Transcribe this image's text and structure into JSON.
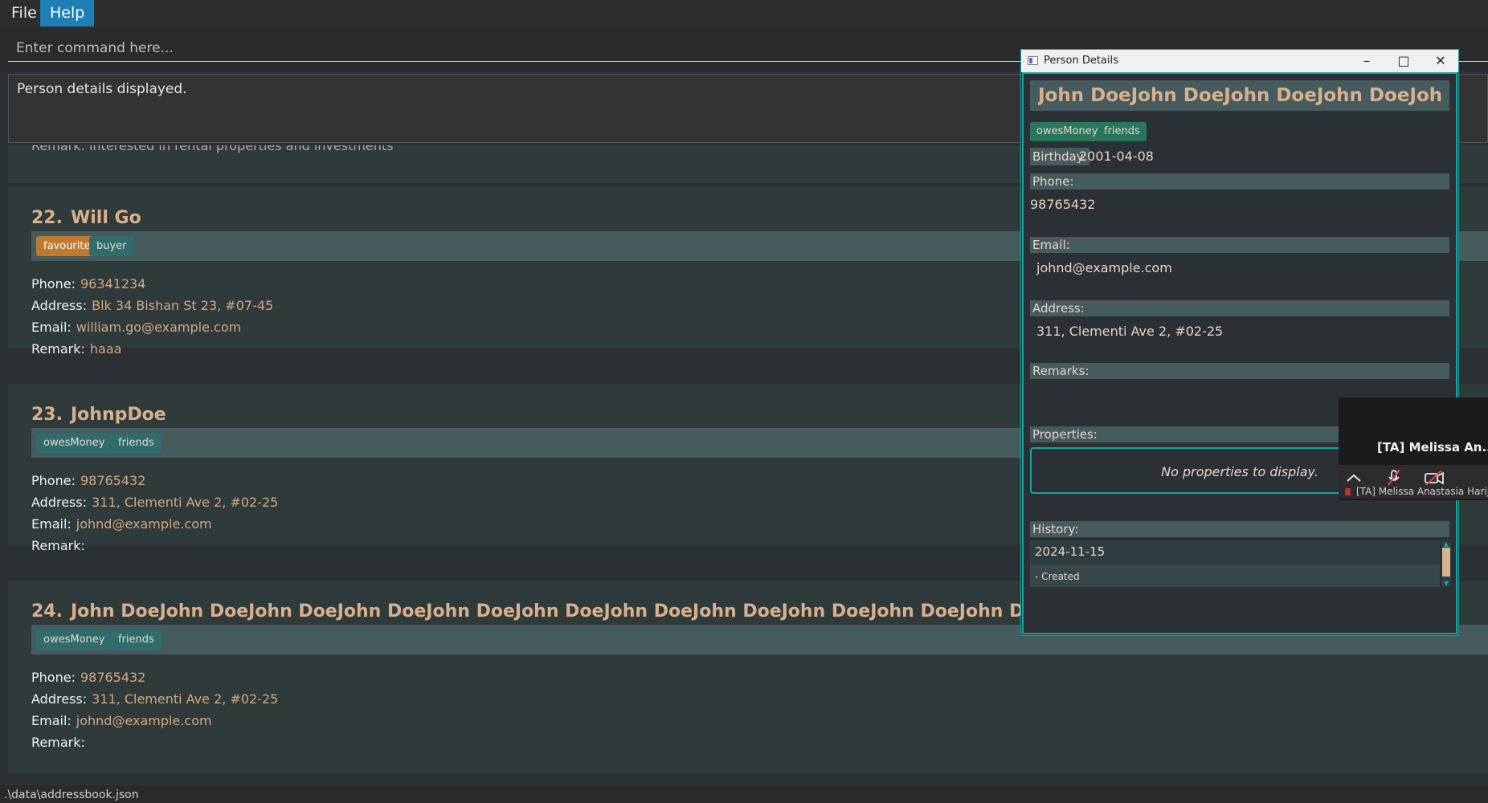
{
  "menu": {
    "file": "File",
    "help": "Help"
  },
  "command": {
    "placeholder": "Enter command here..."
  },
  "result": {
    "text": "Person details displayed."
  },
  "list": {
    "partial_text": "Remark: interested in rental properties and investments",
    "cards": [
      {
        "index": "22.",
        "name": "Will Go",
        "tags": [
          "favourite",
          "buyer"
        ],
        "phone_label": "Phone:",
        "phone": "96341234",
        "address_label": "Address:",
        "address": "Blk 34 Bishan St 23, #07-45",
        "email_label": "Email:",
        "email": "william.go@example.com",
        "remark_label": "Remark:",
        "remark": "haaa"
      },
      {
        "index": "23.",
        "name": "JohnpDoe",
        "tags": [
          "owesMoney",
          "friends"
        ],
        "phone_label": "Phone:",
        "phone": "98765432",
        "address_label": "Address:",
        "address": "311, Clementi Ave 2, #02-25",
        "email_label": "Email:",
        "email": "johnd@example.com",
        "remark_label": "Remark:",
        "remark": ""
      },
      {
        "index": "24.",
        "name": "John DoeJohn DoeJohn DoeJohn DoeJohn DoeJohn DoeJohn DoeJohn DoeJohn DoeJohn DoeJohn D...",
        "tags": [
          "owesMoney",
          "friends"
        ],
        "phone_label": "Phone:",
        "phone": "98765432",
        "address_label": "Address:",
        "address": "311, Clementi Ave 2, #02-25",
        "email_label": "Email:",
        "email": "johnd@example.com",
        "remark_label": "Remark:",
        "remark": ""
      }
    ]
  },
  "status": {
    "path": ".\\data\\addressbook.json"
  },
  "details_window": {
    "title": "Person Details",
    "name": "John DoeJohn DoeJohn DoeJohn DoeJohn ...",
    "tags": [
      "owesMoney",
      "friends"
    ],
    "birthday_label": "Birthday:",
    "birthday": "2001-04-08",
    "phone_label": "Phone:",
    "phone": "98765432",
    "email_label": "Email:",
    "email": "johnd@example.com",
    "address_label": "Address:",
    "address": "311, Clementi Ave 2, #02-25",
    "remarks_label": "Remarks:",
    "remarks": "",
    "properties_label": "Properties:",
    "properties_empty": "No properties to display.",
    "history_label": "History:",
    "history": [
      {
        "date": "2024-11-15",
        "note": "- Created"
      }
    ]
  },
  "call_overlay": {
    "participant": "[TA] Melissa An...",
    "caption": "[TA] Melissa Anastasia Harija"
  },
  "colors": {
    "accent": "#1aa3a0",
    "name": "#d9b08c",
    "tag": "#2f6d6d",
    "favourite_tag": "#c07a2f",
    "help_highlight": "#1e7fb5"
  }
}
